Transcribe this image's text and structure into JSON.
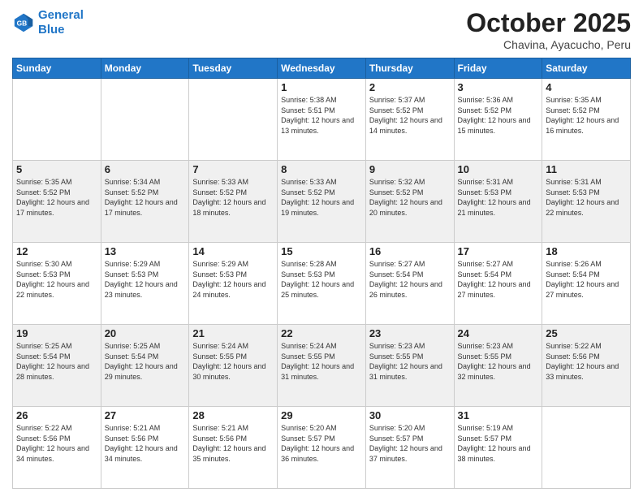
{
  "logo": {
    "line1": "General",
    "line2": "Blue"
  },
  "title": "October 2025",
  "subtitle": "Chavina, Ayacucho, Peru",
  "weekdays": [
    "Sunday",
    "Monday",
    "Tuesday",
    "Wednesday",
    "Thursday",
    "Friday",
    "Saturday"
  ],
  "weeks": [
    [
      {
        "day": "",
        "sunrise": "",
        "sunset": "",
        "daylight": ""
      },
      {
        "day": "",
        "sunrise": "",
        "sunset": "",
        "daylight": ""
      },
      {
        "day": "",
        "sunrise": "",
        "sunset": "",
        "daylight": ""
      },
      {
        "day": "1",
        "sunrise": "Sunrise: 5:38 AM",
        "sunset": "Sunset: 5:51 PM",
        "daylight": "Daylight: 12 hours and 13 minutes."
      },
      {
        "day": "2",
        "sunrise": "Sunrise: 5:37 AM",
        "sunset": "Sunset: 5:52 PM",
        "daylight": "Daylight: 12 hours and 14 minutes."
      },
      {
        "day": "3",
        "sunrise": "Sunrise: 5:36 AM",
        "sunset": "Sunset: 5:52 PM",
        "daylight": "Daylight: 12 hours and 15 minutes."
      },
      {
        "day": "4",
        "sunrise": "Sunrise: 5:35 AM",
        "sunset": "Sunset: 5:52 PM",
        "daylight": "Daylight: 12 hours and 16 minutes."
      }
    ],
    [
      {
        "day": "5",
        "sunrise": "Sunrise: 5:35 AM",
        "sunset": "Sunset: 5:52 PM",
        "daylight": "Daylight: 12 hours and 17 minutes."
      },
      {
        "day": "6",
        "sunrise": "Sunrise: 5:34 AM",
        "sunset": "Sunset: 5:52 PM",
        "daylight": "Daylight: 12 hours and 17 minutes."
      },
      {
        "day": "7",
        "sunrise": "Sunrise: 5:33 AM",
        "sunset": "Sunset: 5:52 PM",
        "daylight": "Daylight: 12 hours and 18 minutes."
      },
      {
        "day": "8",
        "sunrise": "Sunrise: 5:33 AM",
        "sunset": "Sunset: 5:52 PM",
        "daylight": "Daylight: 12 hours and 19 minutes."
      },
      {
        "day": "9",
        "sunrise": "Sunrise: 5:32 AM",
        "sunset": "Sunset: 5:52 PM",
        "daylight": "Daylight: 12 hours and 20 minutes."
      },
      {
        "day": "10",
        "sunrise": "Sunrise: 5:31 AM",
        "sunset": "Sunset: 5:53 PM",
        "daylight": "Daylight: 12 hours and 21 minutes."
      },
      {
        "day": "11",
        "sunrise": "Sunrise: 5:31 AM",
        "sunset": "Sunset: 5:53 PM",
        "daylight": "Daylight: 12 hours and 22 minutes."
      }
    ],
    [
      {
        "day": "12",
        "sunrise": "Sunrise: 5:30 AM",
        "sunset": "Sunset: 5:53 PM",
        "daylight": "Daylight: 12 hours and 22 minutes."
      },
      {
        "day": "13",
        "sunrise": "Sunrise: 5:29 AM",
        "sunset": "Sunset: 5:53 PM",
        "daylight": "Daylight: 12 hours and 23 minutes."
      },
      {
        "day": "14",
        "sunrise": "Sunrise: 5:29 AM",
        "sunset": "Sunset: 5:53 PM",
        "daylight": "Daylight: 12 hours and 24 minutes."
      },
      {
        "day": "15",
        "sunrise": "Sunrise: 5:28 AM",
        "sunset": "Sunset: 5:53 PM",
        "daylight": "Daylight: 12 hours and 25 minutes."
      },
      {
        "day": "16",
        "sunrise": "Sunrise: 5:27 AM",
        "sunset": "Sunset: 5:54 PM",
        "daylight": "Daylight: 12 hours and 26 minutes."
      },
      {
        "day": "17",
        "sunrise": "Sunrise: 5:27 AM",
        "sunset": "Sunset: 5:54 PM",
        "daylight": "Daylight: 12 hours and 27 minutes."
      },
      {
        "day": "18",
        "sunrise": "Sunrise: 5:26 AM",
        "sunset": "Sunset: 5:54 PM",
        "daylight": "Daylight: 12 hours and 27 minutes."
      }
    ],
    [
      {
        "day": "19",
        "sunrise": "Sunrise: 5:25 AM",
        "sunset": "Sunset: 5:54 PM",
        "daylight": "Daylight: 12 hours and 28 minutes."
      },
      {
        "day": "20",
        "sunrise": "Sunrise: 5:25 AM",
        "sunset": "Sunset: 5:54 PM",
        "daylight": "Daylight: 12 hours and 29 minutes."
      },
      {
        "day": "21",
        "sunrise": "Sunrise: 5:24 AM",
        "sunset": "Sunset: 5:55 PM",
        "daylight": "Daylight: 12 hours and 30 minutes."
      },
      {
        "day": "22",
        "sunrise": "Sunrise: 5:24 AM",
        "sunset": "Sunset: 5:55 PM",
        "daylight": "Daylight: 12 hours and 31 minutes."
      },
      {
        "day": "23",
        "sunrise": "Sunrise: 5:23 AM",
        "sunset": "Sunset: 5:55 PM",
        "daylight": "Daylight: 12 hours and 31 minutes."
      },
      {
        "day": "24",
        "sunrise": "Sunrise: 5:23 AM",
        "sunset": "Sunset: 5:55 PM",
        "daylight": "Daylight: 12 hours and 32 minutes."
      },
      {
        "day": "25",
        "sunrise": "Sunrise: 5:22 AM",
        "sunset": "Sunset: 5:56 PM",
        "daylight": "Daylight: 12 hours and 33 minutes."
      }
    ],
    [
      {
        "day": "26",
        "sunrise": "Sunrise: 5:22 AM",
        "sunset": "Sunset: 5:56 PM",
        "daylight": "Daylight: 12 hours and 34 minutes."
      },
      {
        "day": "27",
        "sunrise": "Sunrise: 5:21 AM",
        "sunset": "Sunset: 5:56 PM",
        "daylight": "Daylight: 12 hours and 34 minutes."
      },
      {
        "day": "28",
        "sunrise": "Sunrise: 5:21 AM",
        "sunset": "Sunset: 5:56 PM",
        "daylight": "Daylight: 12 hours and 35 minutes."
      },
      {
        "day": "29",
        "sunrise": "Sunrise: 5:20 AM",
        "sunset": "Sunset: 5:57 PM",
        "daylight": "Daylight: 12 hours and 36 minutes."
      },
      {
        "day": "30",
        "sunrise": "Sunrise: 5:20 AM",
        "sunset": "Sunset: 5:57 PM",
        "daylight": "Daylight: 12 hours and 37 minutes."
      },
      {
        "day": "31",
        "sunrise": "Sunrise: 5:19 AM",
        "sunset": "Sunset: 5:57 PM",
        "daylight": "Daylight: 12 hours and 38 minutes."
      },
      {
        "day": "",
        "sunrise": "",
        "sunset": "",
        "daylight": ""
      }
    ]
  ]
}
